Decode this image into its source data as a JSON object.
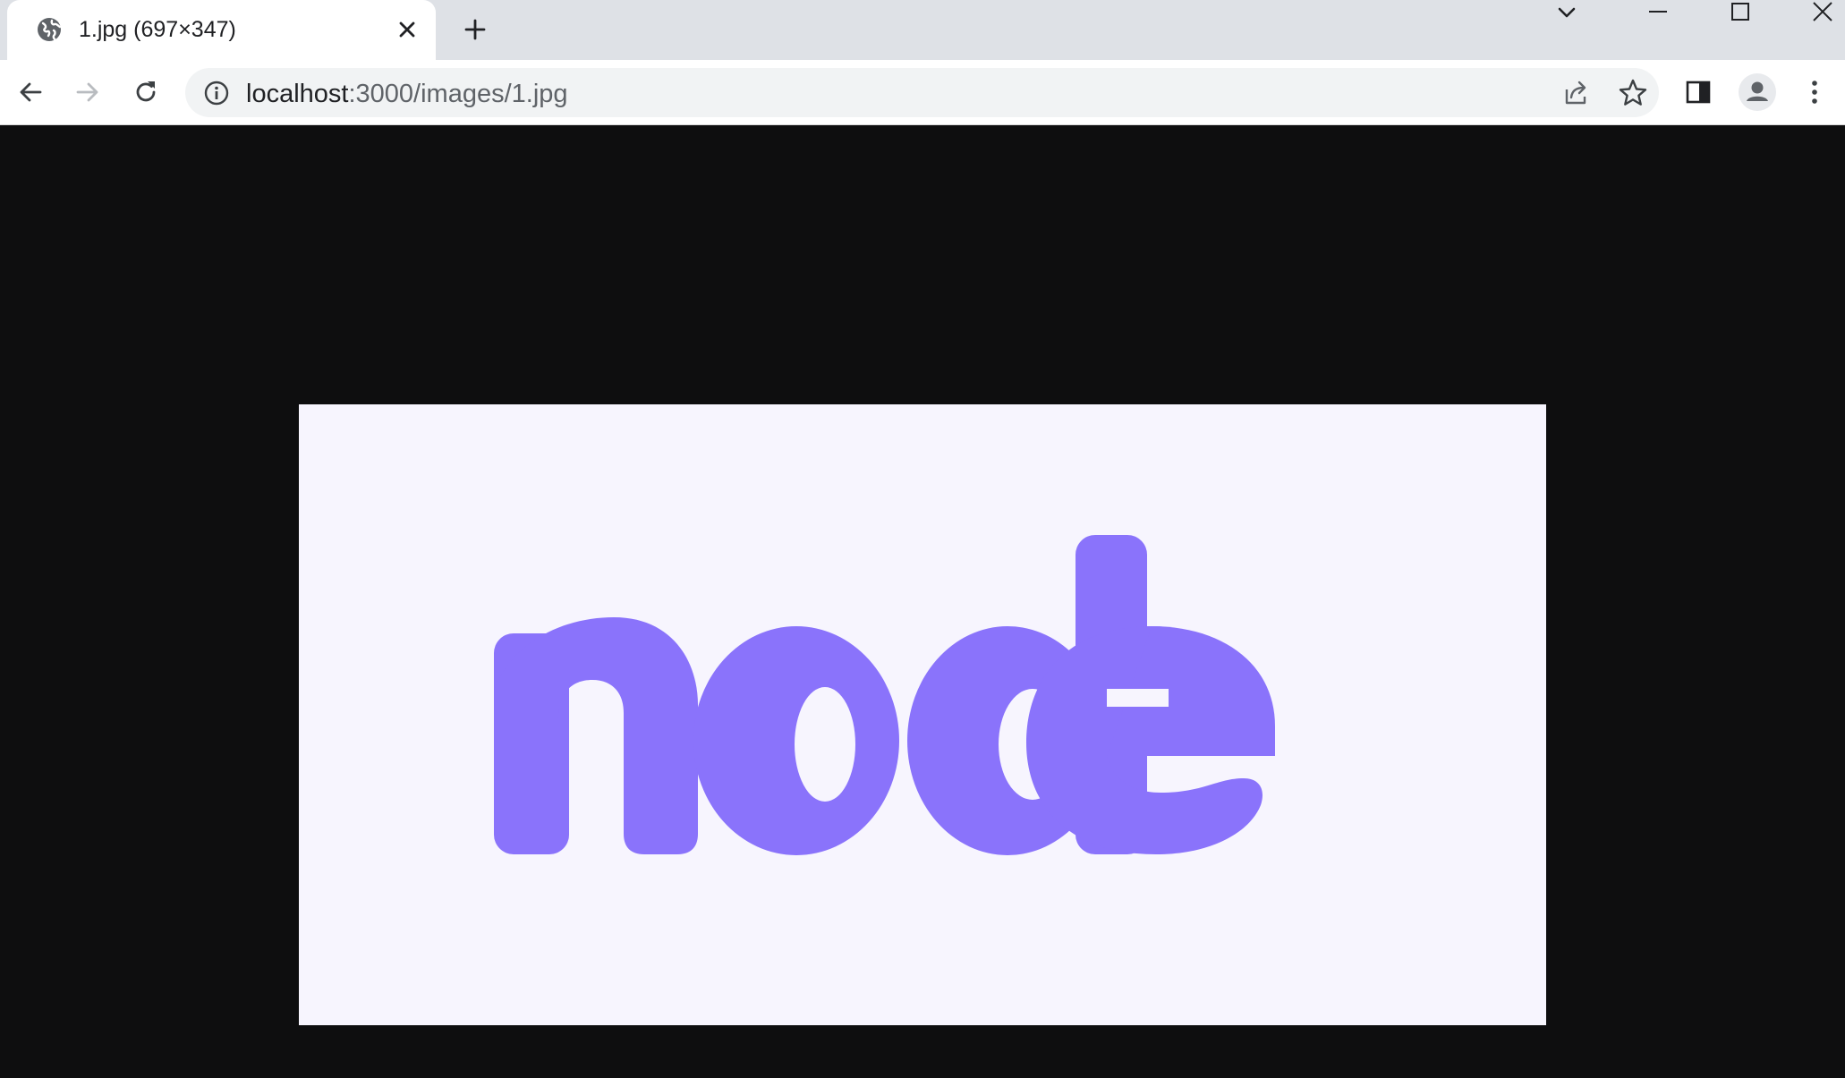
{
  "tab": {
    "title": "1.jpg (697×347)",
    "favicon": "globe-icon"
  },
  "address_bar": {
    "host": "localhost",
    "path": ":3000/images/1.jpg"
  },
  "image": {
    "word": "node",
    "text_color": "#8a73fb",
    "background_color": "#f7f5fe"
  },
  "colors": {
    "tabstrip": "#dee1e6",
    "toolbar": "#ffffff",
    "omnibox": "#f1f3f4",
    "page_background": "#0e0e0f"
  }
}
